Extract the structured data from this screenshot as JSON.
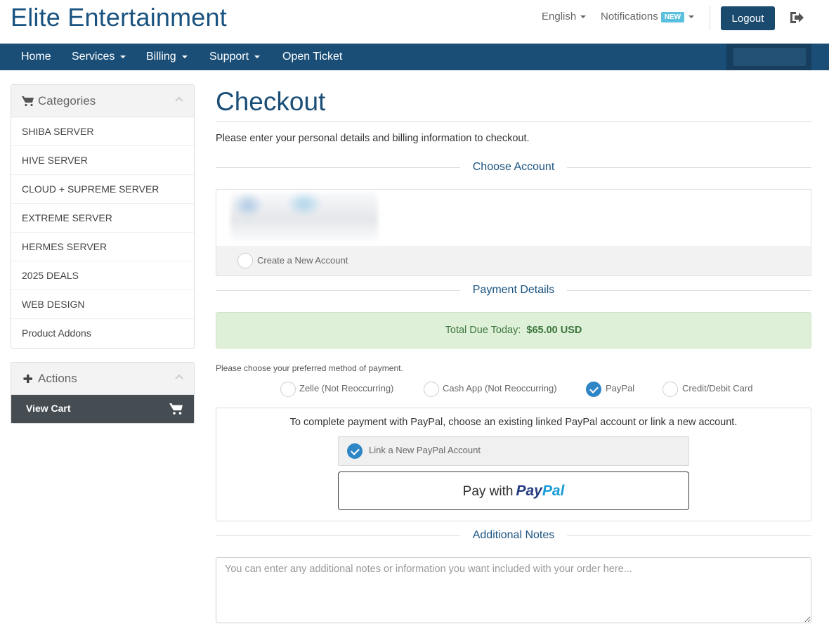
{
  "header": {
    "brand": "Elite Entertainment",
    "language": "English",
    "notifications": "Notifications",
    "notifications_badge": "NEW",
    "logout": "Logout"
  },
  "nav": {
    "items": [
      {
        "label": "Home",
        "dropdown": false
      },
      {
        "label": "Services",
        "dropdown": true
      },
      {
        "label": "Billing",
        "dropdown": true
      },
      {
        "label": "Support",
        "dropdown": true
      },
      {
        "label": "Open Ticket",
        "dropdown": false
      }
    ]
  },
  "sidebar": {
    "categories_title": "Categories",
    "categories": [
      "SHIBA SERVER",
      "HIVE SERVER",
      "CLOUD + SUPREME SERVER",
      "EXTREME SERVER",
      "HERMES SERVER",
      "2025 DEALS",
      "WEB DESIGN",
      "Product Addons"
    ],
    "actions_title": "Actions",
    "view_cart": "View Cart"
  },
  "main": {
    "title": "Checkout",
    "intro": "Please enter your personal details and billing information to checkout.",
    "choose_account_heading": "Choose Account",
    "create_account_label": "Create a New Account",
    "payment_details_heading": "Payment Details",
    "total_label": "Total Due Today:",
    "total_value": "$65.00 USD",
    "choose_method_text": "Please choose your preferred method of payment.",
    "payment_methods": [
      {
        "label": "Zelle (Not Reoccurring)",
        "checked": false
      },
      {
        "label": "Cash App (Not Reoccurring)",
        "checked": false
      },
      {
        "label": "PayPal",
        "checked": true
      },
      {
        "label": "Credit/Debit Card",
        "checked": false
      }
    ],
    "paypal_message": "To complete payment with PayPal, choose an existing linked PayPal account or link a new account.",
    "link_paypal_label": "Link a New PayPal Account",
    "pay_with_text": "Pay with",
    "paypal_logo_part1": "Pay",
    "paypal_logo_part2": "Pal",
    "additional_notes_heading": "Additional Notes",
    "notes_placeholder": "You can enter any additional notes or information you want included with your order here..."
  },
  "colors": {
    "brand": "#1a5380",
    "nav_bg": "#1a4e77",
    "logout_bg": "#1a4a6e",
    "success_bg": "#dff0d8",
    "success_text": "#3c763d",
    "radio_checked": "#2e86c6",
    "sidebar_active": "#454d52"
  },
  "icons": {
    "logout": "sign-out-icon",
    "categories": "shopping-cart-icon",
    "actions": "plus-icon",
    "view_cart": "shopping-cart-icon",
    "collapse": "chevron-up-icon"
  }
}
